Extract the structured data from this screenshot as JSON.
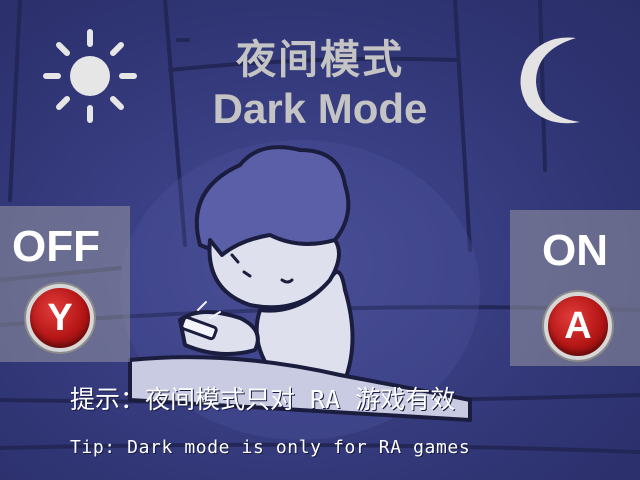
{
  "title": {
    "chinese": "夜间模式",
    "english": "Dark Mode"
  },
  "icons": {
    "sun": "sun-icon",
    "moon": "moon-icon"
  },
  "off_option": {
    "label": "OFF",
    "button_letter": "Y"
  },
  "on_option": {
    "label": "ON",
    "button_letter": "A"
  },
  "tips": {
    "chinese": "提示：夜间模式只对 RA 游戏有效",
    "english": "Tip: Dark mode is only for RA games"
  },
  "colors": {
    "background": "#2f3473",
    "title_text": "#c4c4c4",
    "panel": "#96969f",
    "button_red": "#b51616"
  }
}
